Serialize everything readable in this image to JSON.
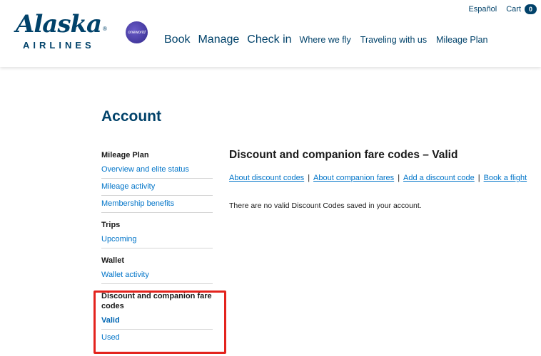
{
  "brand": {
    "logo_word": "Alaska",
    "logo_sub": "AIRLINES",
    "logo_reg": "®",
    "oneworld": "oneworld"
  },
  "utility": {
    "language": "Español",
    "cart_label": "Cart",
    "cart_count": "0"
  },
  "nav": {
    "items": [
      {
        "label": "Book"
      },
      {
        "label": "Manage"
      },
      {
        "label": "Check in"
      },
      {
        "label": "Where we fly"
      },
      {
        "label": "Traveling with us"
      },
      {
        "label": "Mileage Plan"
      }
    ]
  },
  "page": {
    "title": "Account"
  },
  "sidebar": {
    "groups": [
      {
        "heading": "Mileage Plan",
        "links": [
          "Overview and elite status",
          "Mileage activity",
          "Membership benefits"
        ]
      },
      {
        "heading": "Trips",
        "links": [
          "Upcoming"
        ]
      },
      {
        "heading": "Wallet",
        "links": [
          "Wallet activity"
        ]
      },
      {
        "heading": "Discount and companion fare codes",
        "links": [
          "Valid",
          "Used"
        ]
      }
    ]
  },
  "main": {
    "title": "Discount and companion fare codes – Valid",
    "links": [
      "About discount codes",
      "About companion fares",
      "Add a discount code",
      "Book a flight"
    ],
    "separator": "|",
    "message": "There are no valid Discount Codes saved in your account."
  },
  "colors": {
    "brand_navy": "#01426a",
    "link_blue": "#0074c8",
    "highlight_red": "#e3231d"
  }
}
